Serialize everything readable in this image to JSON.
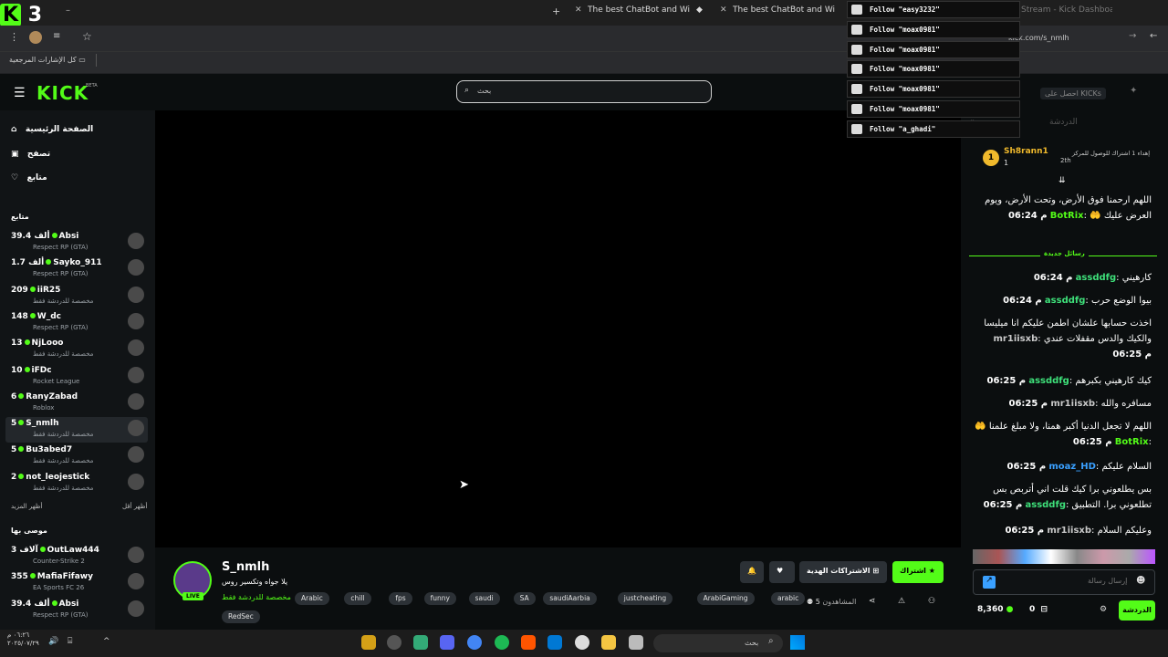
{
  "browser": {
    "tabs": [
      "The best ChatBot and Widgets",
      "The best ChatBot and Widgets",
      "Stream - Kick Dashboard"
    ],
    "url": "kick.com/s_nmlh",
    "bookmarks": "كل الإشارات المرجعية"
  },
  "kick": {
    "logo": "KICK",
    "beta": "BETA",
    "search_placeholder": "بحث",
    "get_kicks": "احصل على KICKs"
  },
  "nav": {
    "home": "الصفحة الرئيسية",
    "browse": "تصفح",
    "following": "متابع"
  },
  "sidebar": {
    "following_title": "متابع",
    "show_more": "أظهر المزيد",
    "show_less": "أظهر أقل",
    "recommended_title": "موصى بها",
    "channels": [
      {
        "viewers": "39.4 ألف",
        "name": "Absi",
        "game": "Respect RP (GTA)"
      },
      {
        "viewers": "1.7 ألف",
        "name": "Sayko_911",
        "game": "Respect RP (GTA)"
      },
      {
        "viewers": "209",
        "name": "iiR25",
        "game": "مخصصة للدردشة فقط"
      },
      {
        "viewers": "148",
        "name": "W_dc",
        "game": "Respect RP (GTA)"
      },
      {
        "viewers": "13",
        "name": "NjLooo",
        "game": "مخصصة للدردشة فقط"
      },
      {
        "viewers": "10",
        "name": "iFDc",
        "game": "Rocket League"
      },
      {
        "viewers": "6",
        "name": "RanyZabad",
        "game": "Roblox"
      },
      {
        "viewers": "5",
        "name": "S_nmlh",
        "game": "مخصصة للدردشة فقط"
      },
      {
        "viewers": "5",
        "name": "Bu3abed7",
        "game": "مخصصة للدردشة فقط"
      },
      {
        "viewers": "2",
        "name": "not_leojestick",
        "game": "مخصصة للدردشة فقط"
      }
    ],
    "recommended": [
      {
        "viewers": "3 آلاف",
        "name": "OutLaw444",
        "game": "Counter-Strike 2"
      },
      {
        "viewers": "355",
        "name": "MafiaFifawy",
        "game": "EA Sports FC 26"
      },
      {
        "viewers": "39.4 ألف",
        "name": "Absi",
        "game": "Respect RP (GTA)"
      }
    ]
  },
  "stream": {
    "name": "S_nmlh",
    "live": "LIVE",
    "title": "يلا جواه وتكسير روس",
    "category": "مخصصة للدردشة فقط",
    "tags": [
      "Arabic",
      "chill",
      "fps",
      "funny",
      "saudi",
      "SA",
      "saudiAarbia",
      "justcheating",
      "ArabiGaming",
      "arabic",
      "RedSec"
    ],
    "subscribe": "اشتراك",
    "gift": "الاشتراكات الهدية",
    "viewers": "5",
    "viewers_label": "المشاهدون"
  },
  "chat": {
    "title": "الدردشة",
    "top_name": "Sh8rann1",
    "top_count": "1",
    "top_text": "إهداء 1 اشتراك للوصول للمركز",
    "top_rank": "2th",
    "new_messages": "رسائل جديدة",
    "input_placeholder": "إرسال رسالة",
    "send": "الدردشة",
    "points": "8,360",
    "zero": "0",
    "messages": [
      {
        "time": "06:24 م",
        "user": "BotRix",
        "color": "#53fc18",
        "text": "اللهم ارحمنا فوق الأرض، وتحت الأرض، ويوم العرض عليك 🤲"
      },
      {
        "time": "06:24 م",
        "user": "assddfg",
        "color": "#3ee07a",
        "text": "كارهيني"
      },
      {
        "time": "06:24 م",
        "user": "assddfg",
        "color": "#3ee07a",
        "text": "بيوا الوضع حرب"
      },
      {
        "time": "06:25 م",
        "user": "mr1iisxb",
        "color": "#c9c9c9",
        "text": "اخذت حسابها علشان اطمن عليكم انا ميليسا والكيك والدس مقفلات عندي"
      },
      {
        "time": "06:25 م",
        "user": "assddfg",
        "color": "#3ee07a",
        "text": "كيك كارهيني بكبرهم"
      },
      {
        "time": "06:25 م",
        "user": "mr1iisxb",
        "color": "#c9c9c9",
        "text": "مسافره والله"
      },
      {
        "time": "06:25 م",
        "user": "BotRix",
        "color": "#53fc18",
        "text": "اللهم لا تجعل الدنيا أكبر همنا، ولا مبلغ علمنا 🤲"
      },
      {
        "time": "06:25 م",
        "user": "moaz_HD",
        "color": "#3aa0ff",
        "text": "السلام عليكم"
      },
      {
        "time": "06:25 م",
        "user": "assddfg",
        "color": "#3ee07a",
        "text": "بس يطلعوني برا كيك قلت اني أتربص بس تطلعوني برا. التطبيق"
      },
      {
        "time": "06:25 م",
        "user": "mr1iisxb",
        "color": "#c9c9c9",
        "text": "وعليكم السلام"
      }
    ]
  },
  "overlay": {
    "follows": [
      "Follow \"easy3232\"",
      "Follow \"moax0981\"",
      "Follow \"moax0981\"",
      "Follow \"moax0981\"",
      "Follow \"moax0981\"",
      "Follow \"moax0981\"",
      "Follow \"a_ghadi\""
    ]
  },
  "taskbar": {
    "search": "بحث",
    "time": "٠٦:٢٦ م",
    "date": "٢٠٢٥/٠٧/٢٩"
  }
}
